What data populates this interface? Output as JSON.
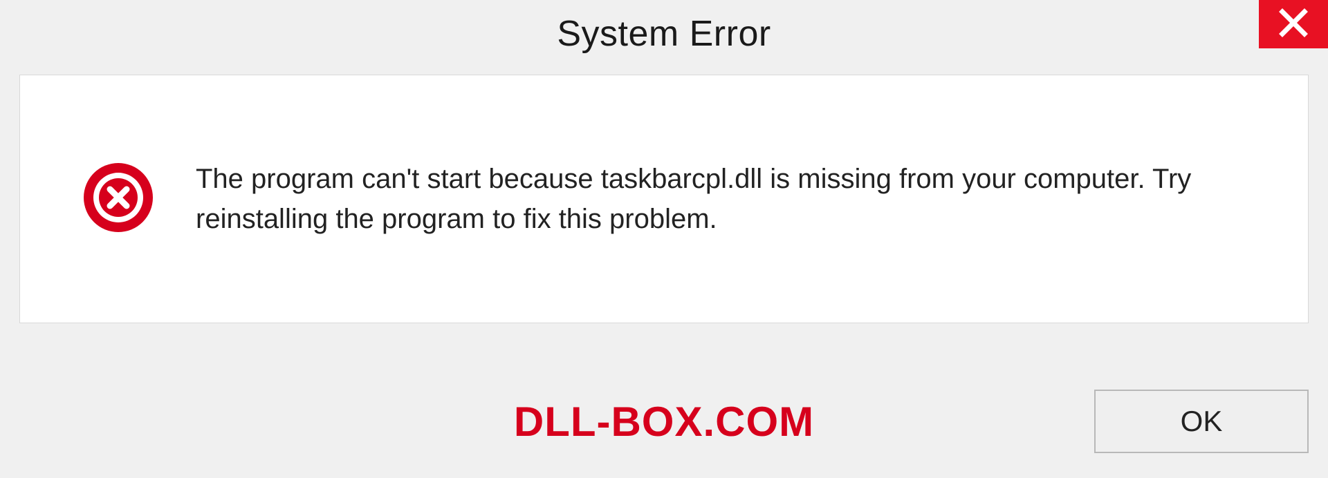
{
  "dialog": {
    "title": "System Error",
    "message": "The program can't start because taskbarcpl.dll is missing from your computer. Try reinstalling the program to fix this problem.",
    "ok_label": "OK"
  },
  "watermark": "DLL-BOX.COM",
  "colors": {
    "accent_red": "#e81123",
    "brand_red": "#d6001c"
  }
}
